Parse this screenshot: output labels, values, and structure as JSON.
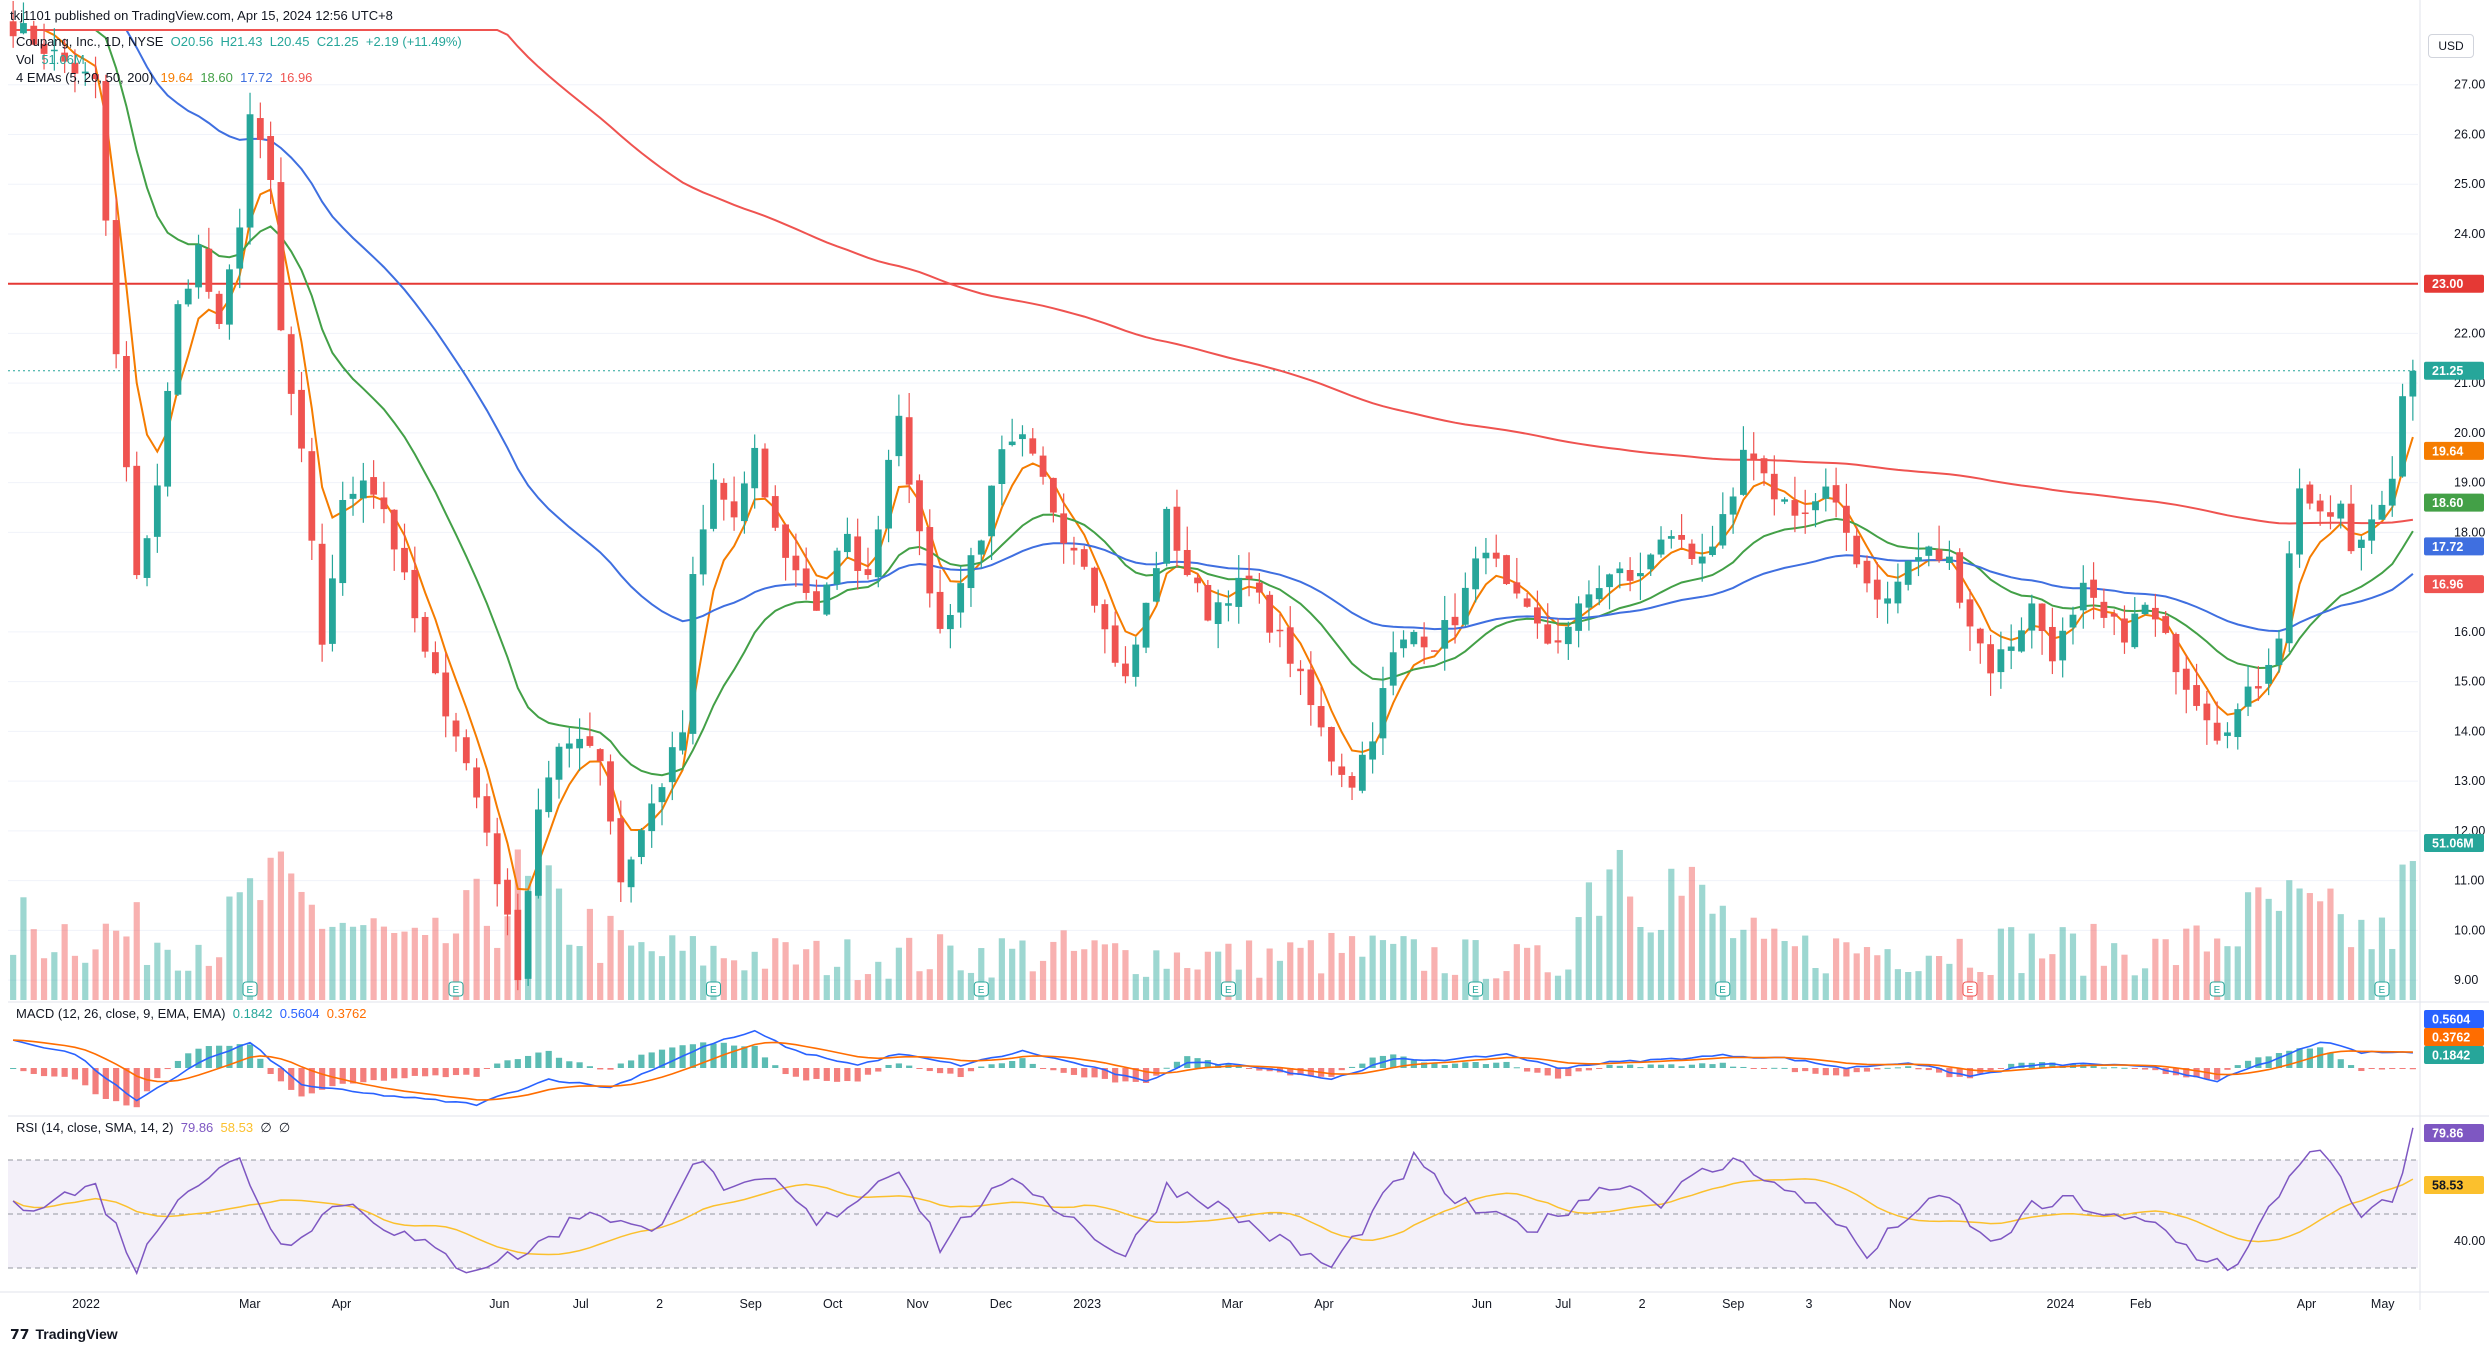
{
  "header": {
    "published": "tkj1101 published on TradingView.com, Apr 15, 2024 12:56 UTC+8",
    "symbol": "Coupang, Inc., 1D, NYSE",
    "ohlc": {
      "o": "O20.56",
      "h": "H21.43",
      "l": "L20.45",
      "c": "C21.25",
      "chg": "+2.19 (+11.49%)"
    },
    "vol_label": "Vol",
    "vol_value": "51.06M",
    "ema_label": "4 EMAs (5, 20, 50, 200)",
    "ema_values": [
      "19.64",
      "18.60",
      "17.72",
      "16.96"
    ],
    "macd_label": "MACD (12, 26, close, 9, EMA, EMA)",
    "macd_values": [
      "0.1842",
      "0.5604",
      "0.3762"
    ],
    "rsi_label": "RSI (14, close, SMA, 14, 2)",
    "rsi_values": [
      "79.86",
      "58.53",
      "∅",
      "∅"
    ]
  },
  "currency": "USD",
  "footer_logo": "TradingView",
  "colors": {
    "up": "#26a69a",
    "down": "#ef5350",
    "ema5": "#f57c00",
    "ema20": "#43a047",
    "ema50": "#3f6fe0",
    "ema200": "#ef5350",
    "hline": "#e53935",
    "macd": "#2962ff",
    "signal": "#ff6d00",
    "rsi": "#7e57c2",
    "rsi_ma": "#fbc02d"
  },
  "chart_data": {
    "type": "candlestick",
    "price_axis": {
      "ticks": [
        "27.00",
        "26.00",
        "25.00",
        "24.00",
        "22.00",
        "21.00",
        "20.00",
        "19.00",
        "18.00",
        "16.00",
        "15.00",
        "14.00",
        "13.00",
        "12.00",
        "11.00",
        "10.00",
        "9.00"
      ],
      "range": [
        8.6,
        28.1
      ]
    },
    "time_axis": [
      "2022",
      "Mar",
      "Apr",
      "Jun",
      "Jul",
      "2",
      "Sep",
      "Oct",
      "Nov",
      "Dec",
      "2023",
      "Mar",
      "Apr",
      "Jun",
      "Jul",
      "2",
      "Sep",
      "3",
      "Nov",
      "2024",
      "Feb",
      "Apr",
      "May"
    ],
    "horizontal_line": {
      "value": 23.0,
      "label": "23.00"
    },
    "last_price": {
      "value": 21.25,
      "label": "21.25"
    },
    "price_badges": [
      {
        "label": "19.64",
        "value": 19.64,
        "series": "ema5"
      },
      {
        "label": "18.60",
        "value": 18.6,
        "series": "ema20"
      },
      {
        "label": "17.72",
        "value": 17.72,
        "series": "ema50"
      },
      {
        "label": "16.96",
        "value": 16.96,
        "series": "ema200"
      }
    ],
    "volume_badge": "51.06M",
    "macd_badges": [
      "0.5604",
      "0.3762",
      "0.1842"
    ],
    "rsi_badges": [
      "79.86",
      "58.53"
    ],
    "rsi_axis_tick": "40.00",
    "rsi_levels": [
      70,
      50,
      30
    ],
    "earnings_markers": [
      "E",
      "E",
      "E",
      "E",
      "E",
      "E",
      "E",
      "E",
      "E",
      "E",
      "E",
      "E",
      "E"
    ],
    "price_path": [
      [
        0,
        28.2
      ],
      [
        8,
        27.0
      ],
      [
        10,
        21.5
      ],
      [
        12,
        17.0
      ],
      [
        14,
        19.0
      ],
      [
        16,
        22.5
      ],
      [
        18,
        23.7
      ],
      [
        20,
        22.0
      ],
      [
        22,
        24.3
      ],
      [
        23,
        26.4
      ],
      [
        25,
        25.0
      ],
      [
        26,
        22.0
      ],
      [
        28,
        19.5
      ],
      [
        30,
        15.8
      ],
      [
        32,
        18.5
      ],
      [
        34,
        19.2
      ],
      [
        36,
        18.5
      ],
      [
        38,
        17.0
      ],
      [
        40,
        15.5
      ],
      [
        43,
        14.0
      ],
      [
        46,
        12.0
      ],
      [
        49,
        9.2
      ],
      [
        51,
        12.5
      ],
      [
        53,
        13.5
      ],
      [
        55,
        14.0
      ],
      [
        57,
        13.5
      ],
      [
        59,
        11.0
      ],
      [
        61,
        12.0
      ],
      [
        63,
        13.0
      ],
      [
        65,
        14.0
      ],
      [
        66,
        17.0
      ],
      [
        68,
        19.0
      ],
      [
        70,
        18.3
      ],
      [
        72,
        19.5
      ],
      [
        74,
        18.0
      ],
      [
        76,
        17.2
      ],
      [
        78,
        16.5
      ],
      [
        80,
        17.5
      ],
      [
        81,
        17.8
      ],
      [
        83,
        17.0
      ],
      [
        85,
        19.5
      ],
      [
        86,
        20.5
      ],
      [
        88,
        17.8
      ],
      [
        90,
        16.0
      ],
      [
        92,
        17.0
      ],
      [
        94,
        18.0
      ],
      [
        96,
        19.5
      ],
      [
        98,
        19.8
      ],
      [
        100,
        19.0
      ],
      [
        102,
        18.0
      ],
      [
        104,
        17.5
      ],
      [
        106,
        16.0
      ],
      [
        108,
        15.0
      ],
      [
        110,
        16.5
      ],
      [
        112,
        18.3
      ],
      [
        114,
        17.2
      ],
      [
        116,
        16.4
      ],
      [
        118,
        16.8
      ],
      [
        120,
        17.0
      ],
      [
        122,
        16.2
      ],
      [
        124,
        15.5
      ],
      [
        126,
        14.5
      ],
      [
        128,
        13.5
      ],
      [
        130,
        13.0
      ],
      [
        132,
        14.0
      ],
      [
        134,
        15.5
      ],
      [
        136,
        16.0
      ],
      [
        138,
        15.8
      ],
      [
        140,
        16.3
      ],
      [
        142,
        17.3
      ],
      [
        143,
        17.8
      ],
      [
        145,
        16.8
      ],
      [
        147,
        16.3
      ],
      [
        149,
        15.8
      ],
      [
        151,
        16.0
      ],
      [
        153,
        16.8
      ],
      [
        155,
        17.2
      ],
      [
        157,
        17.0
      ],
      [
        159,
        17.5
      ],
      [
        161,
        18.0
      ],
      [
        163,
        17.5
      ],
      [
        165,
        17.8
      ],
      [
        167,
        18.5
      ],
      [
        168,
        19.6
      ],
      [
        170,
        19.0
      ],
      [
        172,
        18.6
      ],
      [
        174,
        18.4
      ],
      [
        176,
        18.8
      ],
      [
        178,
        18.0
      ],
      [
        180,
        17.0
      ],
      [
        182,
        16.6
      ],
      [
        184,
        17.4
      ],
      [
        186,
        17.6
      ],
      [
        188,
        17.4
      ],
      [
        190,
        16.2
      ],
      [
        192,
        15.3
      ],
      [
        194,
        15.8
      ],
      [
        196,
        16.5
      ],
      [
        198,
        15.6
      ],
      [
        200,
        16.2
      ],
      [
        201,
        16.8
      ],
      [
        203,
        16.2
      ],
      [
        205,
        16.0
      ],
      [
        207,
        16.5
      ],
      [
        209,
        15.8
      ],
      [
        211,
        15.0
      ],
      [
        213,
        14.4
      ],
      [
        214,
        14.0
      ],
      [
        216,
        14.4
      ],
      [
        218,
        15.0
      ],
      [
        220,
        16.0
      ],
      [
        221,
        17.5
      ],
      [
        222,
        19.0
      ],
      [
        224,
        18.2
      ],
      [
        226,
        18.5
      ],
      [
        227,
        17.5
      ],
      [
        229,
        18.3
      ],
      [
        231,
        19.2
      ],
      [
        232,
        20.6
      ],
      [
        233,
        21.3
      ]
    ],
    "volume_path": [
      [
        0,
        0.6
      ],
      [
        20,
        0.5
      ],
      [
        24,
        0.9
      ],
      [
        40,
        0.4
      ],
      [
        49,
        0.9
      ],
      [
        60,
        0.4
      ],
      [
        80,
        0.35
      ],
      [
        100,
        0.4
      ],
      [
        120,
        0.35
      ],
      [
        130,
        0.4
      ],
      [
        150,
        0.3
      ],
      [
        155,
        1.35
      ],
      [
        170,
        0.4
      ],
      [
        190,
        0.45
      ],
      [
        210,
        0.4
      ],
      [
        220,
        0.75
      ],
      [
        230,
        0.5
      ],
      [
        233,
        1.0
      ]
    ],
    "macd_path": [
      [
        0,
        1.0
      ],
      [
        6,
        0.5
      ],
      [
        12,
        -1.2
      ],
      [
        18,
        0.2
      ],
      [
        23,
        0.9
      ],
      [
        28,
        -0.6
      ],
      [
        34,
        -0.9
      ],
      [
        45,
        -1.3
      ],
      [
        52,
        -0.4
      ],
      [
        58,
        -0.7
      ],
      [
        63,
        0.1
      ],
      [
        68,
        0.9
      ],
      [
        72,
        1.3
      ],
      [
        76,
        0.6
      ],
      [
        82,
        0.1
      ],
      [
        86,
        0.5
      ],
      [
        92,
        0.1
      ],
      [
        98,
        0.6
      ],
      [
        104,
        0.1
      ],
      [
        110,
        -0.5
      ],
      [
        114,
        0.2
      ],
      [
        120,
        0.1
      ],
      [
        128,
        -0.4
      ],
      [
        134,
        0.3
      ],
      [
        140,
        0.3
      ],
      [
        145,
        0.5
      ],
      [
        150,
        0.0
      ],
      [
        155,
        0.2
      ],
      [
        160,
        0.3
      ],
      [
        166,
        0.45
      ],
      [
        172,
        0.35
      ],
      [
        178,
        0.0
      ],
      [
        184,
        0.2
      ],
      [
        190,
        -0.3
      ],
      [
        196,
        0.1
      ],
      [
        202,
        0.15
      ],
      [
        208,
        0.0
      ],
      [
        214,
        -0.45
      ],
      [
        220,
        0.35
      ],
      [
        224,
        0.95
      ],
      [
        228,
        0.55
      ],
      [
        233,
        0.56
      ]
    ],
    "rsi_path": [
      [
        0,
        52
      ],
      [
        8,
        60
      ],
      [
        12,
        30
      ],
      [
        16,
        58
      ],
      [
        22,
        70
      ],
      [
        26,
        38
      ],
      [
        32,
        55
      ],
      [
        38,
        42
      ],
      [
        44,
        30
      ],
      [
        50,
        36
      ],
      [
        56,
        52
      ],
      [
        62,
        42
      ],
      [
        66,
        70
      ],
      [
        70,
        58
      ],
      [
        74,
        62
      ],
      [
        78,
        46
      ],
      [
        82,
        56
      ],
      [
        86,
        68
      ],
      [
        90,
        38
      ],
      [
        94,
        55
      ],
      [
        98,
        62
      ],
      [
        104,
        45
      ],
      [
        108,
        34
      ],
      [
        112,
        60
      ],
      [
        116,
        55
      ],
      [
        122,
        42
      ],
      [
        128,
        30
      ],
      [
        132,
        50
      ],
      [
        136,
        70
      ],
      [
        140,
        55
      ],
      [
        144,
        48
      ],
      [
        148,
        45
      ],
      [
        152,
        55
      ],
      [
        156,
        62
      ],
      [
        160,
        55
      ],
      [
        164,
        65
      ],
      [
        168,
        70
      ],
      [
        172,
        58
      ],
      [
        176,
        52
      ],
      [
        180,
        34
      ],
      [
        184,
        50
      ],
      [
        188,
        56
      ],
      [
        192,
        38
      ],
      [
        196,
        52
      ],
      [
        200,
        55
      ],
      [
        204,
        48
      ],
      [
        208,
        46
      ],
      [
        212,
        35
      ],
      [
        216,
        30
      ],
      [
        220,
        58
      ],
      [
        223,
        75
      ],
      [
        225,
        68
      ],
      [
        228,
        48
      ],
      [
        231,
        55
      ],
      [
        233,
        80
      ]
    ]
  }
}
